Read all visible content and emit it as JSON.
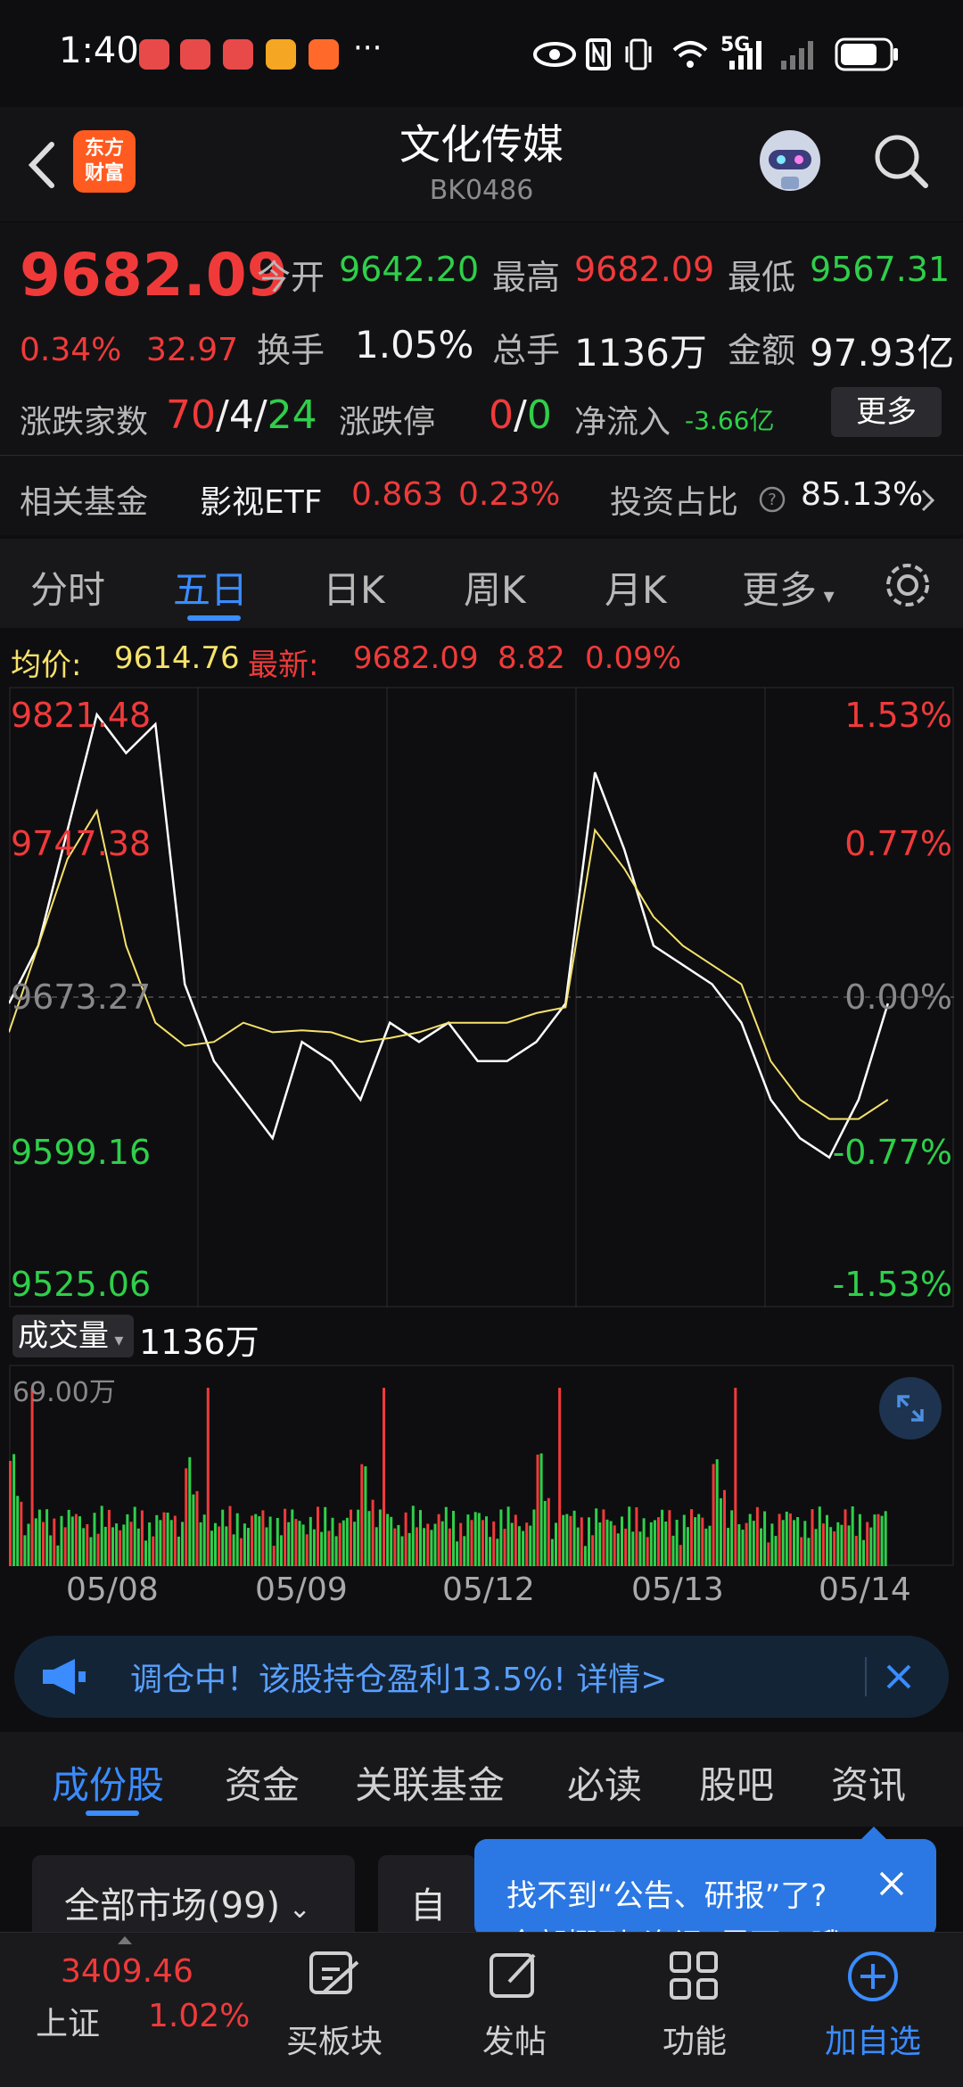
{
  "status_bar": {
    "time": "1:40",
    "dots": "···",
    "network": "5G"
  },
  "header": {
    "title": "文化传媒",
    "code": "BK0486",
    "logo_text": "东方\n财富"
  },
  "quote": {
    "price": "9682.09",
    "change_pct": "0.34%",
    "change": "32.97",
    "open_label": "今开",
    "open": "9642.20",
    "high_label": "最高",
    "high": "9682.09",
    "low_label": "最低",
    "low": "9567.31",
    "turnover_label": "换手",
    "turnover": "1.05%",
    "volume_label": "总手",
    "volume": "1136万",
    "amount_label": "金额",
    "amount": "97.93亿",
    "updown_label": "涨跌家数",
    "up_count": "70",
    "flat_count": "4",
    "down_count": "24",
    "limit_label": "涨跌停",
    "limit_up": "0",
    "limit_down": "0",
    "netflow_label": "净流入",
    "netflow": "-3.66亿",
    "more_button": "更多",
    "fund_label": "相关基金",
    "fund_name": "影视ETF",
    "fund_price": "0.863",
    "fund_change": "0.23%",
    "ratio_label": "投资占比",
    "ratio": "85.13%"
  },
  "tabs": [
    "分时",
    "五日",
    "日K",
    "周K",
    "月K",
    "更多"
  ],
  "active_tab": "五日",
  "avg_bar": {
    "avg_label": "均价:",
    "avg": "9614.76",
    "latest_label": "最新:",
    "latest": "9682.09",
    "change": "8.82",
    "change_pct": "0.09%"
  },
  "chart_data": {
    "type": "line",
    "title": "",
    "x": [
      "05/08",
      "05/09",
      "05/12",
      "05/13",
      "05/14"
    ],
    "y_ticks_left": [
      "9821.48",
      "9747.38",
      "9673.27",
      "9599.16",
      "9525.06"
    ],
    "y_ticks_right": [
      "1.53%",
      "0.77%",
      "0.00%",
      "-0.77%",
      "-1.53%"
    ],
    "ylim": [
      9525.06,
      9821.48
    ],
    "base": 9673.27,
    "series": [
      {
        "values": [
          9670,
          9700,
          9760,
          9820,
          9800,
          9815,
          9680,
          9640,
          9620,
          9600,
          9650,
          9640,
          9620,
          9660,
          9650,
          9660,
          9640,
          9640,
          9650,
          9670,
          9790,
          9750,
          9700,
          9690,
          9680,
          9660,
          9620,
          9600,
          9590,
          9620,
          9670
        ]
      },
      {
        "values": [
          9655,
          9700,
          9745,
          9770,
          9700,
          9660,
          9648,
          9650,
          9660,
          9655,
          9656,
          9655,
          9650,
          9652,
          9655,
          9660,
          9660,
          9660,
          9665,
          9668,
          9760,
          9740,
          9715,
          9700,
          9690,
          9680,
          9640,
          9620,
          9610,
          9610,
          9620
        ]
      }
    ],
    "volume_label": "成交量",
    "volume_total": "1136万",
    "volume_max_label": "69.00万",
    "colors": {
      "price": "#ffffff",
      "avg": "#f5e26b",
      "up": "#f03a3a",
      "down": "#2fcf4a"
    }
  },
  "promo": {
    "text": "调仓中！该股持仓盈利13.5%! 详情>"
  },
  "section_tabs": [
    "成份股",
    "资金",
    "关联基金",
    "必读",
    "股吧",
    "资讯"
  ],
  "active_section_tab": "成份股",
  "filter": {
    "market": "全部市场(99)",
    "fav": "自选"
  },
  "tip": {
    "line1": "找不到“公告、研报”了?",
    "line2": "全部挪到“资讯”里面了哦"
  },
  "bottom_bar": {
    "index_value": "3409.46",
    "index_name": "上证",
    "index_change": "1.02%",
    "items": [
      "买板块",
      "发帖",
      "功能",
      "加自选"
    ]
  }
}
